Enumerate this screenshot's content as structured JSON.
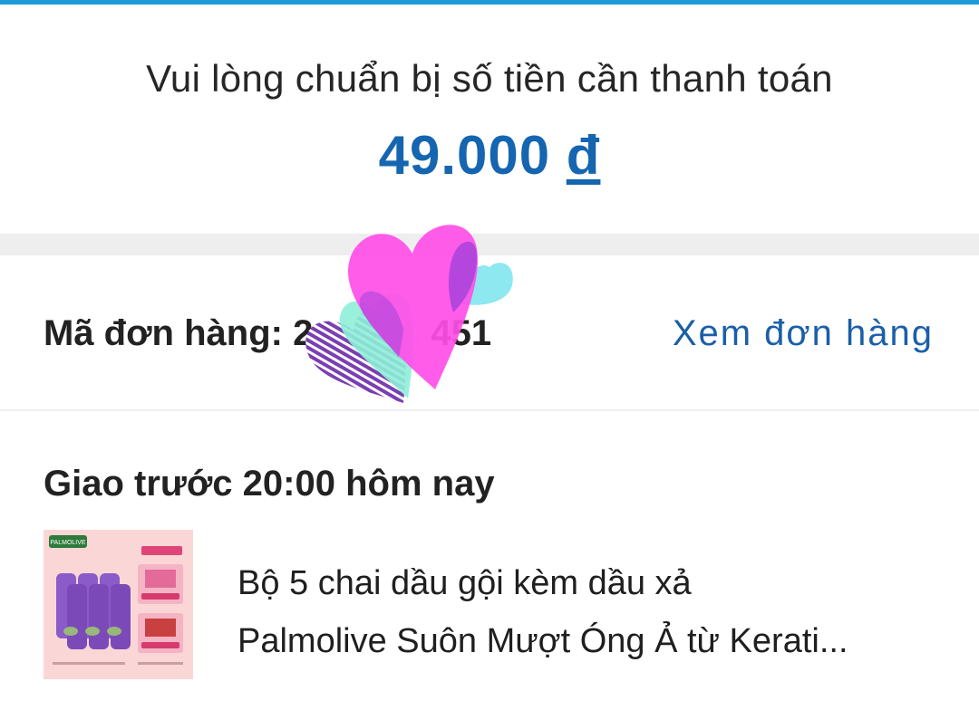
{
  "payment": {
    "prompt": "Vui lòng chuẩn bị số tiền cần thanh toán",
    "amount": "49.000",
    "currency": "đ"
  },
  "order": {
    "label_prefix": "Mã đơn hàng: 2",
    "label_suffix": "451",
    "view_link": "Xem đơn hàng"
  },
  "delivery": {
    "title": "Giao trước 20:00 hôm nay"
  },
  "product": {
    "name_line1": "Bộ 5 chai dầu gội kèm dầu xả",
    "name_line2": "Palmolive Suôn Mượt Óng Ả từ Kerati...",
    "thumb_brand": "PALMOLIVE"
  },
  "colors": {
    "accent": "#1f9ad6",
    "amount": "#1565b0",
    "link": "#1a5fa8"
  }
}
